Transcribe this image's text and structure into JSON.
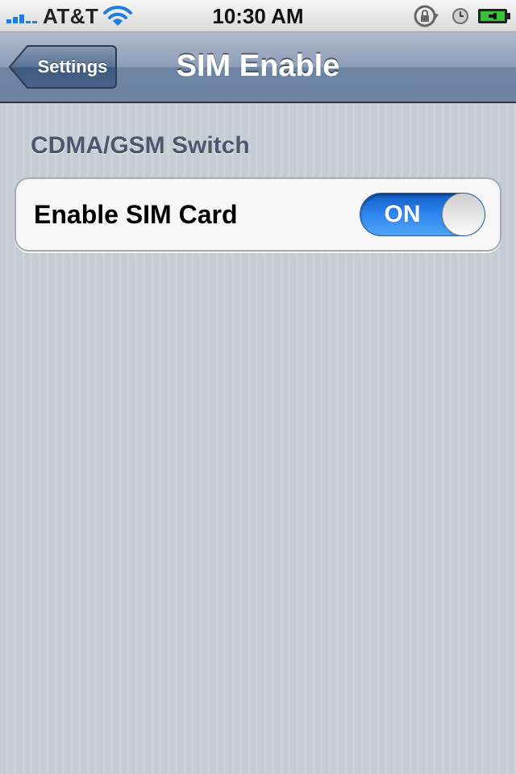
{
  "status_bar": {
    "carrier": "AT&T",
    "time": "10:30 AM",
    "icons": [
      "signal-icon",
      "wifi-icon",
      "rotation-lock-icon",
      "alarm-icon",
      "battery-charging-icon"
    ],
    "colors": {
      "signal": "#1f7de0",
      "battery": "#38c238"
    }
  },
  "nav_bar": {
    "back_label": "Settings",
    "title": "SIM Enable"
  },
  "section": {
    "header": "CDMA/GSM Switch",
    "rows": [
      {
        "label": "Enable SIM Card",
        "toggle_text": "ON",
        "toggle_state": "on"
      }
    ]
  },
  "colors": {
    "background": "#c5ccd4",
    "nav_bar": "#6d84a2",
    "toggle_on": "#2f88f0",
    "section_header": "#4c566c"
  }
}
